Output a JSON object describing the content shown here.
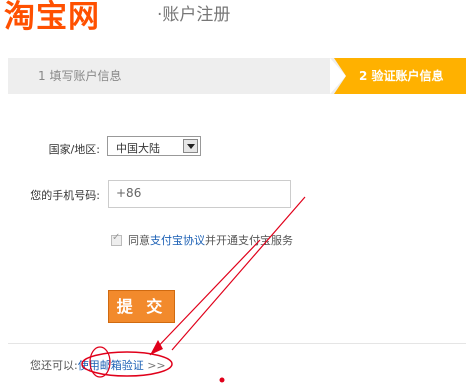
{
  "header": {
    "logo": "淘宝网",
    "title": "·账户注册"
  },
  "steps": [
    {
      "label": "1 填写账户信息",
      "active": false
    },
    {
      "label": "2 验证账户信息",
      "active": true
    }
  ],
  "form": {
    "country_label": "国家/地区:",
    "country_value": "中国大陆",
    "phone_label": "您的手机号码:",
    "phone_value": "+86",
    "agree_prefix": "同意",
    "agree_link": "支付宝协议",
    "agree_suffix": "并开通支付宝服务",
    "agree_checked": true,
    "submit_label": "提 交"
  },
  "footer": {
    "prefix": "您还可以:",
    "link": "使用邮箱验证",
    "arrow": ">>"
  },
  "colors": {
    "brand": "#ff5000",
    "step_active": "#ffb100",
    "submit": "#f28a2c",
    "annotation": "#e0001a"
  }
}
